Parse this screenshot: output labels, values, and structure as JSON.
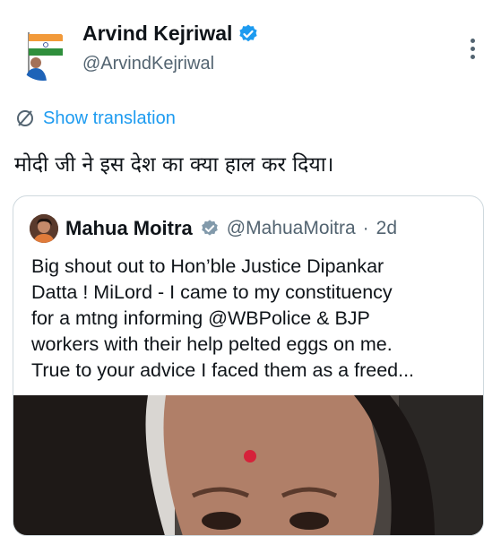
{
  "author": {
    "name": "Arvind Kejriwal",
    "handle": "@ArvindKejriwal",
    "verified": true,
    "avatar_icon": "flag-person-avatar-icon"
  },
  "menu": {
    "icon": "more-vertical-icon"
  },
  "translation": {
    "label": "Show translation",
    "icon": "translate-globe-icon",
    "color": "#1d9bf0"
  },
  "tweet": {
    "text": "मोदी जी ने इस देश का क्या हाल कर दिया।"
  },
  "quoted": {
    "name": "Mahua Moitra",
    "handle": "@MahuaMoitra",
    "separator": "·",
    "time": "2d",
    "verified": true,
    "lines": [
      "Big shout out to Hon’ble Justice Dipankar",
      "Datta ! MiLord - I came to my constituency",
      "for a mtng informing @WBPolice & BJP",
      "workers with their help pelted eggs on me.",
      "True to your advice I faced them as a freed..."
    ],
    "media_icon": "video-thumbnail"
  },
  "colors": {
    "accent": "#1d9bf0",
    "muted": "#536471",
    "text": "#0f1419",
    "border": "#cfd9de"
  }
}
